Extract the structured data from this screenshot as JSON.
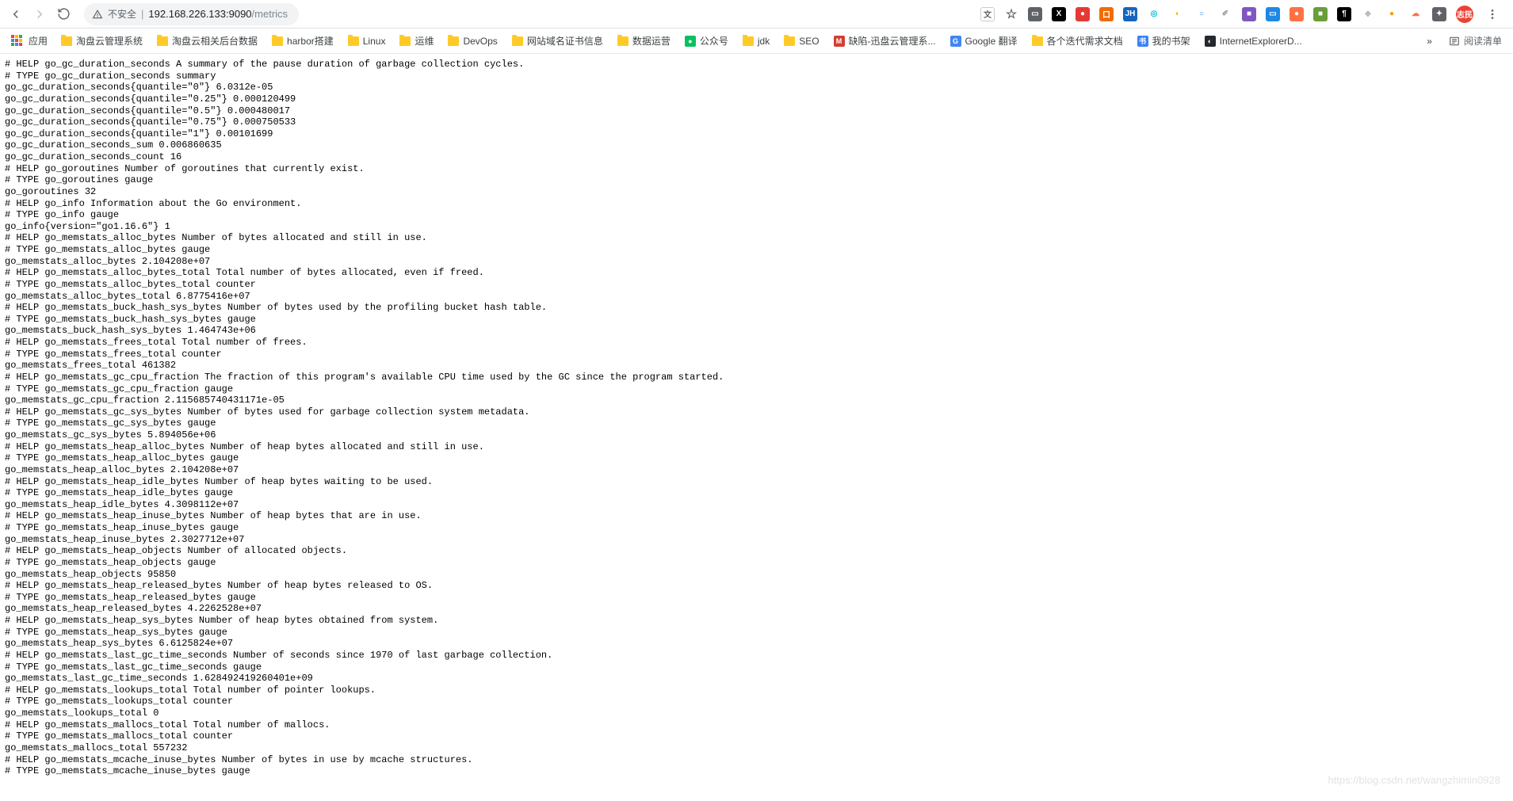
{
  "url_host": "192.168.226.133:9090",
  "url_path": "/metrics",
  "security_label": "不安全",
  "apps_label": "应用",
  "bookmarks": [
    {
      "label": "淘盘云管理系统",
      "icon": "folder"
    },
    {
      "label": "淘盘云相关后台数据",
      "icon": "folder"
    },
    {
      "label": "harbor搭建",
      "icon": "folder"
    },
    {
      "label": "Linux",
      "icon": "folder"
    },
    {
      "label": "运维",
      "icon": "folder"
    },
    {
      "label": "DevOps",
      "icon": "folder"
    },
    {
      "label": "网站域名证书信息",
      "icon": "folder"
    },
    {
      "label": "数据运营",
      "icon": "folder"
    },
    {
      "label": "公众号",
      "icon": "fav",
      "favbg": "#07c160",
      "favtxt": "●"
    },
    {
      "label": "jdk",
      "icon": "folder"
    },
    {
      "label": "SEO",
      "icon": "folder"
    },
    {
      "label": "缺陷-迅盘云管理系...",
      "icon": "fav",
      "favbg": "#d23f31",
      "favtxt": "M"
    },
    {
      "label": "Google 翻译",
      "icon": "fav",
      "favbg": "#4285f4",
      "favtxt": "G"
    },
    {
      "label": "各个迭代需求文档",
      "icon": "folder"
    },
    {
      "label": "我的书架",
      "icon": "fav",
      "favbg": "#3b82f6",
      "favtxt": "书"
    },
    {
      "label": "InternetExplorerD...",
      "icon": "fav",
      "favbg": "#24292e",
      "favtxt": "◐"
    }
  ],
  "overflow_label": "»",
  "reading_list_label": "阅读清单",
  "avatar_text": "志民",
  "ext_icons": [
    {
      "bg": "#5f6368",
      "txt": "▭"
    },
    {
      "bg": "#000000",
      "txt": "X"
    },
    {
      "bg": "#e53935",
      "txt": "●"
    },
    {
      "bg": "#ef6c00",
      "txt": "口"
    },
    {
      "bg": "#1565c0",
      "txt": "JH"
    },
    {
      "bg": "#ffffff",
      "txt": "◎",
      "fg": "#00bcd4"
    },
    {
      "bg": "#ffffff",
      "txt": "◐",
      "fg": "#ffb300"
    },
    {
      "bg": "#ffffff",
      "txt": "○",
      "fg": "#1e88e5"
    },
    {
      "bg": "#ffffff",
      "txt": "✐",
      "fg": "#9e9e9e"
    },
    {
      "bg": "#7e57c2",
      "txt": "■"
    },
    {
      "bg": "#1e88e5",
      "txt": "▭"
    },
    {
      "bg": "#ff7043",
      "txt": "●"
    },
    {
      "bg": "#689f38",
      "txt": "■"
    },
    {
      "bg": "#000000",
      "txt": "¶"
    },
    {
      "bg": "#ffffff",
      "txt": "◆",
      "fg": "#bdbdbd"
    },
    {
      "bg": "#ffffff",
      "txt": "●",
      "fg": "#ff9800"
    },
    {
      "bg": "#ffffff",
      "txt": "☁",
      "fg": "#ff7043"
    },
    {
      "bg": "#5f6368",
      "txt": "✦"
    }
  ],
  "star_icon": "☆",
  "g_translate_icon": "文",
  "watermark": "https://blog.csdn.net/wangzhimin0928",
  "metrics": "# HELP go_gc_duration_seconds A summary of the pause duration of garbage collection cycles.\n# TYPE go_gc_duration_seconds summary\ngo_gc_duration_seconds{quantile=\"0\"} 6.0312e-05\ngo_gc_duration_seconds{quantile=\"0.25\"} 0.000120499\ngo_gc_duration_seconds{quantile=\"0.5\"} 0.000480017\ngo_gc_duration_seconds{quantile=\"0.75\"} 0.000750533\ngo_gc_duration_seconds{quantile=\"1\"} 0.00101699\ngo_gc_duration_seconds_sum 0.006860635\ngo_gc_duration_seconds_count 16\n# HELP go_goroutines Number of goroutines that currently exist.\n# TYPE go_goroutines gauge\ngo_goroutines 32\n# HELP go_info Information about the Go environment.\n# TYPE go_info gauge\ngo_info{version=\"go1.16.6\"} 1\n# HELP go_memstats_alloc_bytes Number of bytes allocated and still in use.\n# TYPE go_memstats_alloc_bytes gauge\ngo_memstats_alloc_bytes 2.104208e+07\n# HELP go_memstats_alloc_bytes_total Total number of bytes allocated, even if freed.\n# TYPE go_memstats_alloc_bytes_total counter\ngo_memstats_alloc_bytes_total 6.8775416e+07\n# HELP go_memstats_buck_hash_sys_bytes Number of bytes used by the profiling bucket hash table.\n# TYPE go_memstats_buck_hash_sys_bytes gauge\ngo_memstats_buck_hash_sys_bytes 1.464743e+06\n# HELP go_memstats_frees_total Total number of frees.\n# TYPE go_memstats_frees_total counter\ngo_memstats_frees_total 461382\n# HELP go_memstats_gc_cpu_fraction The fraction of this program's available CPU time used by the GC since the program started.\n# TYPE go_memstats_gc_cpu_fraction gauge\ngo_memstats_gc_cpu_fraction 2.115685740431171e-05\n# HELP go_memstats_gc_sys_bytes Number of bytes used for garbage collection system metadata.\n# TYPE go_memstats_gc_sys_bytes gauge\ngo_memstats_gc_sys_bytes 5.894056e+06\n# HELP go_memstats_heap_alloc_bytes Number of heap bytes allocated and still in use.\n# TYPE go_memstats_heap_alloc_bytes gauge\ngo_memstats_heap_alloc_bytes 2.104208e+07\n# HELP go_memstats_heap_idle_bytes Number of heap bytes waiting to be used.\n# TYPE go_memstats_heap_idle_bytes gauge\ngo_memstats_heap_idle_bytes 4.3098112e+07\n# HELP go_memstats_heap_inuse_bytes Number of heap bytes that are in use.\n# TYPE go_memstats_heap_inuse_bytes gauge\ngo_memstats_heap_inuse_bytes 2.3027712e+07\n# HELP go_memstats_heap_objects Number of allocated objects.\n# TYPE go_memstats_heap_objects gauge\ngo_memstats_heap_objects 95850\n# HELP go_memstats_heap_released_bytes Number of heap bytes released to OS.\n# TYPE go_memstats_heap_released_bytes gauge\ngo_memstats_heap_released_bytes 4.2262528e+07\n# HELP go_memstats_heap_sys_bytes Number of heap bytes obtained from system.\n# TYPE go_memstats_heap_sys_bytes gauge\ngo_memstats_heap_sys_bytes 6.6125824e+07\n# HELP go_memstats_last_gc_time_seconds Number of seconds since 1970 of last garbage collection.\n# TYPE go_memstats_last_gc_time_seconds gauge\ngo_memstats_last_gc_time_seconds 1.628492419260401e+09\n# HELP go_memstats_lookups_total Total number of pointer lookups.\n# TYPE go_memstats_lookups_total counter\ngo_memstats_lookups_total 0\n# HELP go_memstats_mallocs_total Total number of mallocs.\n# TYPE go_memstats_mallocs_total counter\ngo_memstats_mallocs_total 557232\n# HELP go_memstats_mcache_inuse_bytes Number of bytes in use by mcache structures.\n# TYPE go_memstats_mcache_inuse_bytes gauge"
}
